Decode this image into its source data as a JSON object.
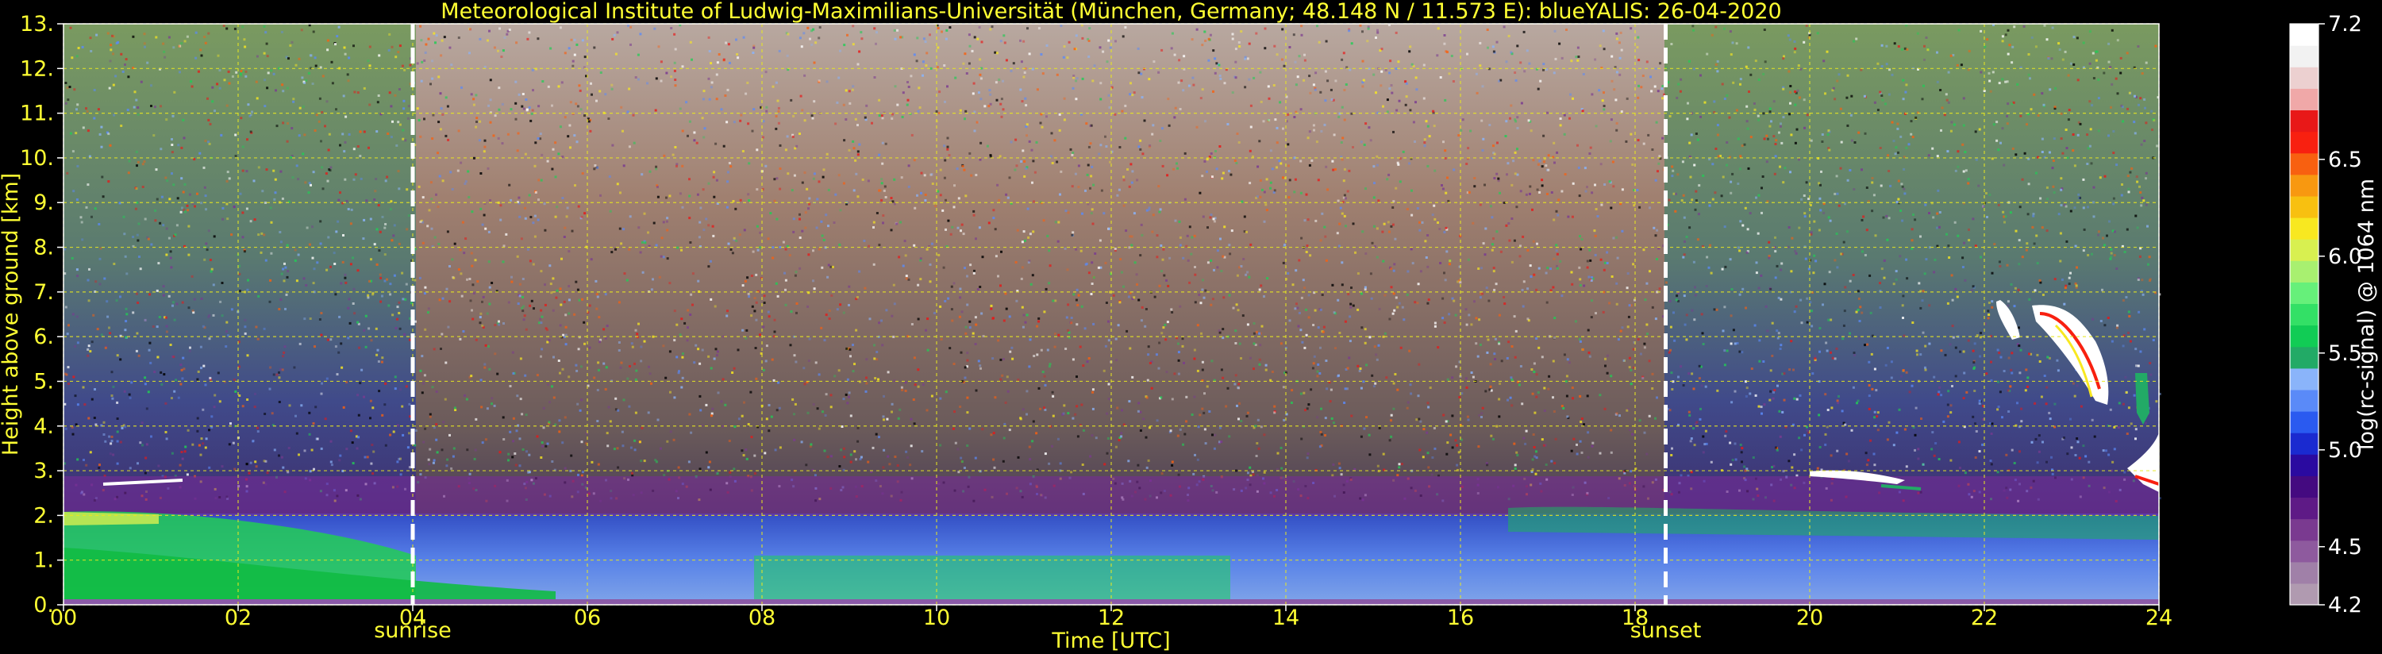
{
  "chart_data": {
    "type": "heatmap",
    "title": "Meteorological Institute of Ludwig-Maximilians-Universität (München, Germany; 48.148 N / 11.573 E):    blueYALIS: 26-04-2020",
    "xlabel": "Time [UTC]",
    "ylabel": "Height above ground [km]",
    "xlim": [
      0,
      24
    ],
    "ylim": [
      0,
      13
    ],
    "x_ticks": [
      "00",
      "02",
      "04",
      "06",
      "08",
      "10",
      "12",
      "14",
      "16",
      "18",
      "20",
      "22",
      "24"
    ],
    "y_ticks": [
      "0.",
      "1.",
      "2.",
      "3.",
      "4.",
      "5.",
      "6.",
      "7.",
      "8.",
      "9.",
      "10.",
      "11.",
      "12.",
      "13."
    ],
    "grid": true,
    "events": [
      {
        "label": "sunrise",
        "x": 4.0
      },
      {
        "label": "sunset",
        "x": 18.35
      }
    ],
    "colorbar": {
      "label": "log(rc-signal) @ 1064 nm",
      "range": [
        4.2,
        7.2
      ],
      "ticks": [
        "4.2",
        "4.5",
        "5.0",
        "5.5",
        "6.0",
        "6.5",
        "7.2"
      ],
      "colors": [
        "#b09ab0",
        "#a080a8",
        "#8e5a9e",
        "#7a3a90",
        "#5e1a86",
        "#440a80",
        "#2a0aa0",
        "#1a2ad0",
        "#2a5af0",
        "#5a8af8",
        "#8ab4fa",
        "#22aa66",
        "#11cc55",
        "#33e066",
        "#66f07a",
        "#a8f070",
        "#d8f050",
        "#f8e820",
        "#f8c010",
        "#f89810",
        "#f86010",
        "#f82010",
        "#e81818",
        "#f0a8a8",
        "#ecd0d0",
        "#f2f2f2",
        "#ffffff"
      ]
    }
  }
}
